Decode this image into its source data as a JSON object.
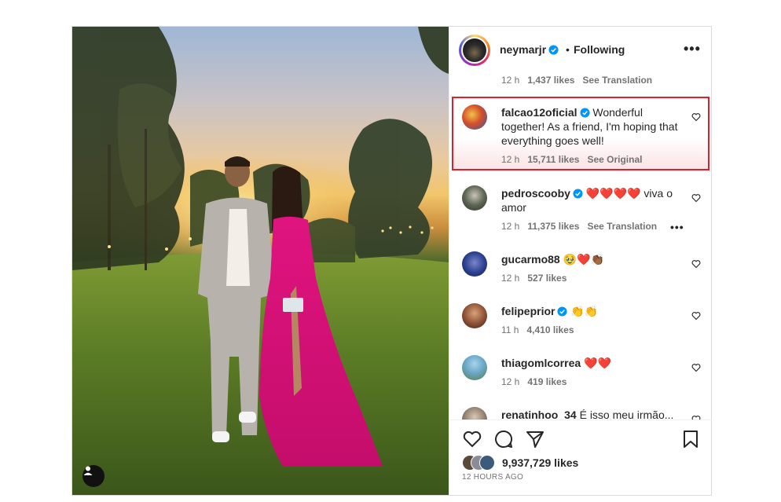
{
  "post": {
    "author": "neymarjr",
    "separator": "•",
    "follow_status": "Following",
    "more_label": "•••",
    "caption_time": "12 h",
    "caption_likes": "1,437 likes",
    "caption_action": "See Translation"
  },
  "comments": [
    {
      "user": "falcao12oficial",
      "verified": true,
      "text": "Wonderful together! As a friend, I'm hoping that everything goes well!",
      "time": "12 h",
      "likes": "15,711 likes",
      "action": "See Original",
      "highlighted": true
    },
    {
      "user": "pedroscooby",
      "verified": true,
      "text": "❤️❤️❤️❤️ viva o amor",
      "time": "12 h",
      "likes": "11,375 likes",
      "action": "See Translation",
      "more": "•••"
    },
    {
      "user": "gucarmo88",
      "verified": false,
      "text": "🥹❤️👏🏾",
      "time": "12 h",
      "likes": "527 likes",
      "action": ""
    },
    {
      "user": "felipeprior",
      "verified": true,
      "text": "👏👏",
      "time": "11 h",
      "likes": "4,410 likes",
      "action": ""
    },
    {
      "user": "thiagomlcorrea",
      "verified": false,
      "text": "❤️❤️",
      "time": "12 h",
      "likes": "419 likes",
      "action": ""
    },
    {
      "user": "renatinhoo_34",
      "verified": false,
      "text": "É isso meu irmão...",
      "time": "",
      "likes": "",
      "action": ""
    }
  ],
  "footer": {
    "likes": "9,937,729 likes",
    "time_ago": "12 HOURS AGO"
  },
  "icons": [
    "verified-badge-icon",
    "heart-icon",
    "comment-icon",
    "share-icon",
    "bookmark-icon",
    "user-tag-icon",
    "more-icon"
  ],
  "colors": {
    "verified": "#0095f6",
    "highlight_border": "#e01e2e",
    "text": "#262626",
    "muted": "#737373"
  }
}
